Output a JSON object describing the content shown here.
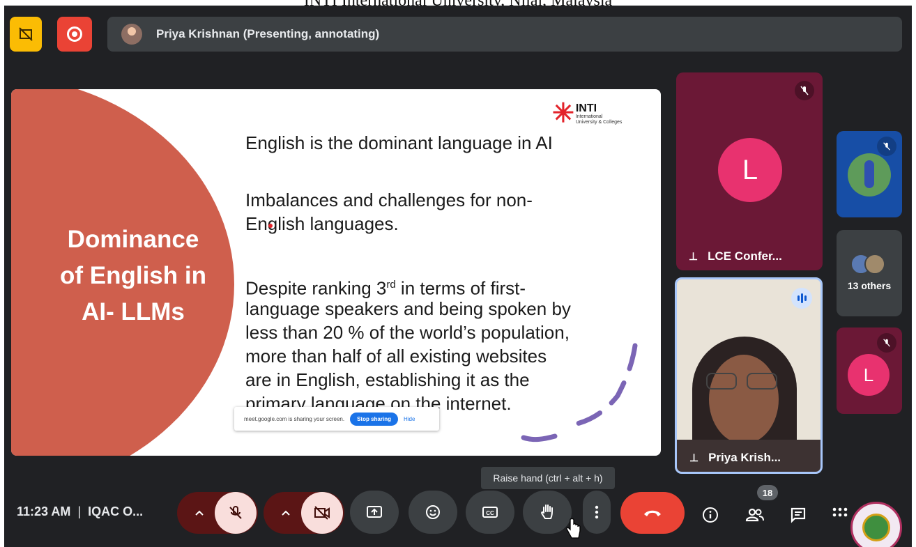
{
  "caption": "INTI International University, Nilai, Malaysia",
  "header": {
    "presenter_label": "Priya Krishnan (Presenting, annotating)",
    "icons": [
      "hand-off-icon",
      "record-icon"
    ]
  },
  "slide": {
    "title_lines": [
      "Dominance",
      "of English in",
      "AI- LLMs"
    ],
    "logo": {
      "name": "INTI",
      "sub1": "International",
      "sub2": "University & Colleges"
    },
    "lines": [
      "English is the dominant language in AI",
      "Imbalances and challenges for non-",
      "English languages.",
      "Despite ranking 3",
      "rd",
      " in terms of first-",
      "language speakers and being spoken by",
      "less than 20 % of the world’s population,",
      "more than half of all existing websites",
      "are in English, establishing it as the",
      "primary language on the internet."
    ],
    "share_bar": {
      "text": "meet.google.com is sharing your screen.",
      "stop": "Stop sharing",
      "hide": "Hide"
    }
  },
  "participants": {
    "lce": {
      "initial": "L",
      "name": "LCE Confer..."
    },
    "priya": {
      "name": "Priya Krish..."
    },
    "others": {
      "label": "13 others"
    },
    "small_l": {
      "initial": "L"
    }
  },
  "controls": {
    "time": "11:23 AM",
    "separator": "|",
    "meeting": "IQAC O...",
    "tooltip": "Raise hand (ctrl + alt + h)",
    "people_count": "18",
    "icons": [
      "chevron-up-icon",
      "mic-off-icon",
      "camera-off-icon",
      "present-icon",
      "emoji-icon",
      "captions-icon",
      "raise-hand-icon",
      "more-icon",
      "end-call-icon",
      "info-icon",
      "people-icon",
      "chat-icon",
      "activities-icon"
    ]
  },
  "colors": {
    "meet_bg": "#202124",
    "slide_accent": "#cf5f4d",
    "end_call": "#ea4335",
    "avatar_pink": "#e8326f",
    "tile_maroon": "#6b1836"
  }
}
